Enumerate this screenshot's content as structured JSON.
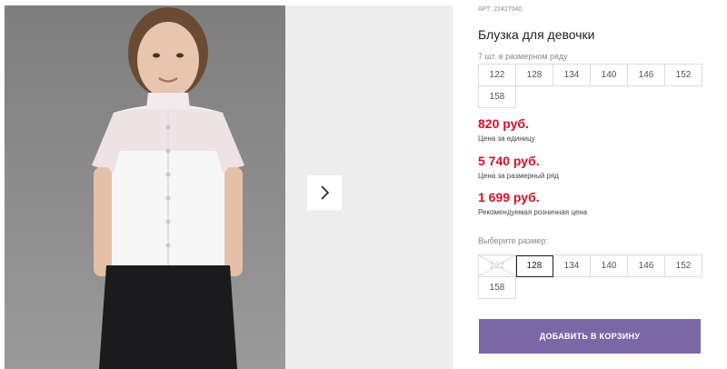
{
  "product": {
    "article": "АРТ: 22427040",
    "title": "Блузка для девочки"
  },
  "pack": {
    "label": "7 шт. в размерном ряду",
    "sizes": [
      "122",
      "128",
      "134",
      "140",
      "146",
      "152",
      "158"
    ]
  },
  "prices": {
    "unit_price": "820 руб.",
    "unit_label": "Цена за единицу",
    "pack_price": "5 740 руб.",
    "pack_label": "Цена за размерный ряд",
    "retail_price": "1 699 руб.",
    "retail_label": "Рекомендуемая розничная цена"
  },
  "size_select": {
    "label": "Выберите размер:",
    "options": [
      "122",
      "128",
      "134",
      "140",
      "146",
      "152",
      "158"
    ],
    "selected": "128",
    "unavailable": "122"
  },
  "cart": {
    "add_label": "ДОБАВИТЬ В КОРЗИНУ"
  },
  "colors": {
    "price_red": "#d5112a",
    "button_purple": "#7b67a6"
  },
  "icons": {
    "gallery_next": "chevron-right-icon"
  }
}
